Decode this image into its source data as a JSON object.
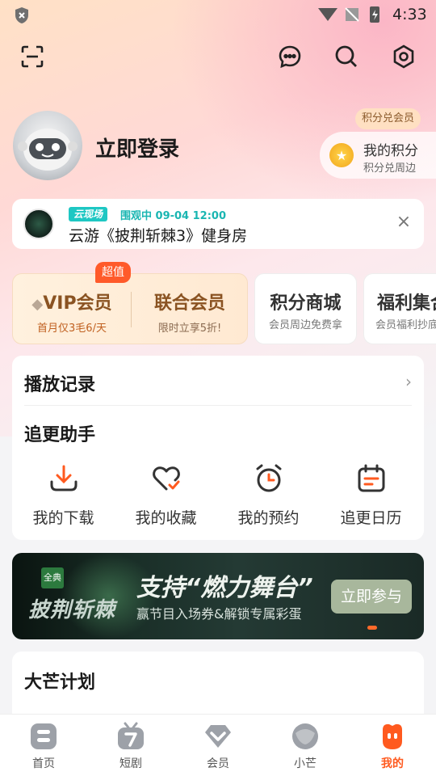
{
  "status_bar": {
    "time": "4:33"
  },
  "profile": {
    "login_label": "立即登录"
  },
  "points": {
    "badge": "积分兑会员",
    "title": "我的积分",
    "subtitle": "积分兑周边"
  },
  "live": {
    "tag": "云现场",
    "status": "围观中 09-04 12:00",
    "title": "云游《披荆斩棘3》健身房",
    "close_symbol": "×"
  },
  "vip": {
    "badge": "超值",
    "vip_title": "VIP会员",
    "vip_sub": "首月仅3毛6/天",
    "union_title": "联合会员",
    "union_sub": "限时立享5折!"
  },
  "mall_cards": [
    {
      "title": "积分商城",
      "sub": "会员周边免费拿"
    },
    {
      "title": "福利集合",
      "sub": "会员福利抄底"
    }
  ],
  "history": {
    "title": "播放记录",
    "chevron": "›"
  },
  "helper": {
    "title": "追更助手",
    "items": [
      {
        "label": "我的下载",
        "icon": "download-icon"
      },
      {
        "label": "我的收藏",
        "icon": "heart-check-icon"
      },
      {
        "label": "我的预约",
        "icon": "alarm-clock-icon"
      },
      {
        "label": "追更日历",
        "icon": "calendar-icon"
      }
    ]
  },
  "banner": {
    "tag": "全典",
    "logo": "披荆斩棘",
    "title": "支持“燃力舞台”",
    "subtitle": "赢节目入场券&解锁专属彩蛋",
    "button": "立即参与"
  },
  "damang": {
    "title": "大芒计划"
  },
  "tabs": [
    {
      "label": "首页",
      "icon": "home-icon"
    },
    {
      "label": "短剧",
      "icon": "short-drama-icon"
    },
    {
      "label": "会员",
      "icon": "vip-diamond-icon"
    },
    {
      "label": "小芒",
      "icon": "xiaomang-icon"
    },
    {
      "label": "我的",
      "icon": "mine-icon",
      "active": true
    }
  ],
  "colors": {
    "accent": "#ff5a1f",
    "vip_brown": "#8a5322",
    "live_teal": "#1ec7c3"
  }
}
